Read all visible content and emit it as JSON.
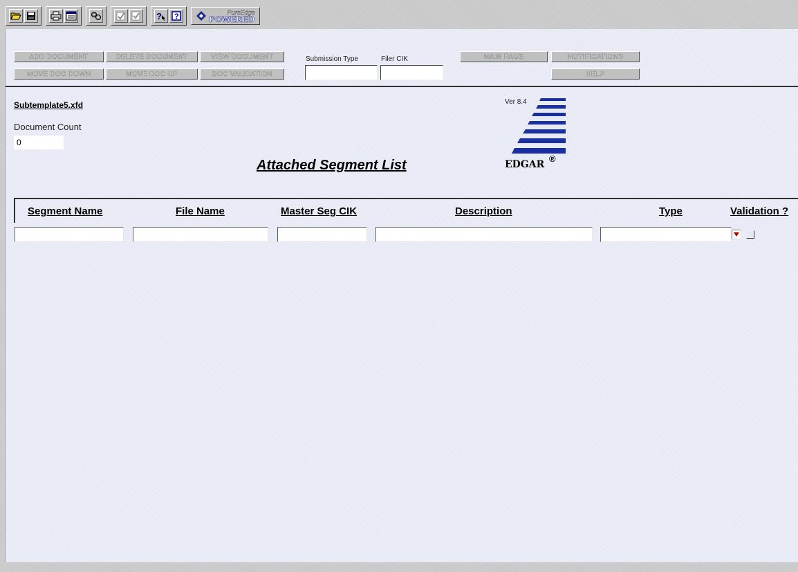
{
  "toolbar": {
    "groups": [
      [
        "open-icon",
        "save-icon"
      ],
      [
        "print-icon",
        "print-preview-icon"
      ],
      [
        "settings-icon"
      ],
      [
        "validate-icon",
        "check-icon"
      ],
      [
        "context-help-icon",
        "help-icon"
      ]
    ],
    "powered": {
      "top": "PureEdge",
      "bottom": "POWERED"
    }
  },
  "buttons": {
    "add_document": "ADD DOCUMENT",
    "delete_document": "DELETE DOCUMENT",
    "view_document": "VIEW DOCUMENT",
    "move_doc_down": "MOVE DOC DOWN",
    "move_doc_up": "MOVE DOC UP",
    "doc_validation": "DOC VALIDATION",
    "main_page": "MAIN PAGE",
    "notifications": "NOTIFICATIONS",
    "help": "HELP"
  },
  "submission": {
    "submission_type_label": "Submission Type",
    "submission_type_value": "",
    "filer_cik_label": "Filer CIK",
    "filer_cik_value": ""
  },
  "file_name": "Subtemplate5.xfd",
  "document_count": {
    "label": "Document Count",
    "value": "0"
  },
  "title": "Attached Segment List",
  "logo": {
    "version": "Ver 8.4",
    "word": "EDGAR",
    "reg": "®"
  },
  "table": {
    "columns": [
      "Segment Name",
      "File Name",
      "Master Seg CIK",
      "Description",
      "Type",
      "Validation ?"
    ],
    "row": {
      "segment_name": "",
      "file_name": "",
      "master_seg_cik": "",
      "description": "",
      "type": "",
      "validation": false
    }
  },
  "colors": {
    "panel": "#e6e9f4",
    "logo_blue": "#1a2fa0",
    "dropdown_arrow": "#b00000"
  }
}
